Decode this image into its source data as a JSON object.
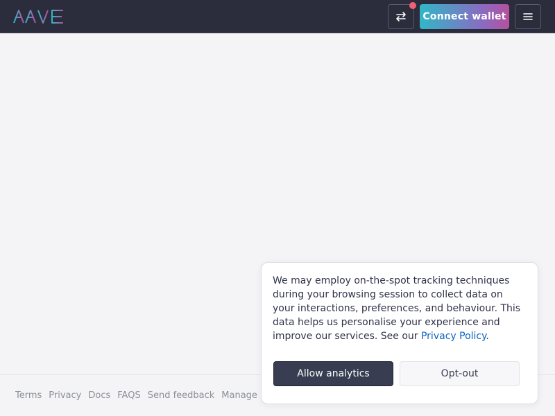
{
  "header": {
    "logo_text": "AAVE",
    "swap_icon": "swap-arrows-icon",
    "connect_label": "Connect wallet",
    "menu_icon": "hamburger-menu-icon"
  },
  "colors": {
    "header_bg": "#2b2d3c",
    "notify_dot": "#f45f73",
    "gradient_start": "#31b7c7",
    "gradient_end": "#b6509e",
    "link": "#0b62bd"
  },
  "cookie": {
    "text": "We may employ on-the-spot tracking techniques during your browsing session to collect data on your interactions, preferences, and behaviour. This data helps us personalise your experience and improve our services. See our ",
    "link_label": "Privacy Policy",
    "text_end": ".",
    "allow_label": "Allow analytics",
    "optout_label": "Opt-out"
  },
  "footer": {
    "links": [
      "Terms",
      "Privacy",
      "Docs",
      "FAQS",
      "Send feedback",
      "Manage an"
    ]
  }
}
